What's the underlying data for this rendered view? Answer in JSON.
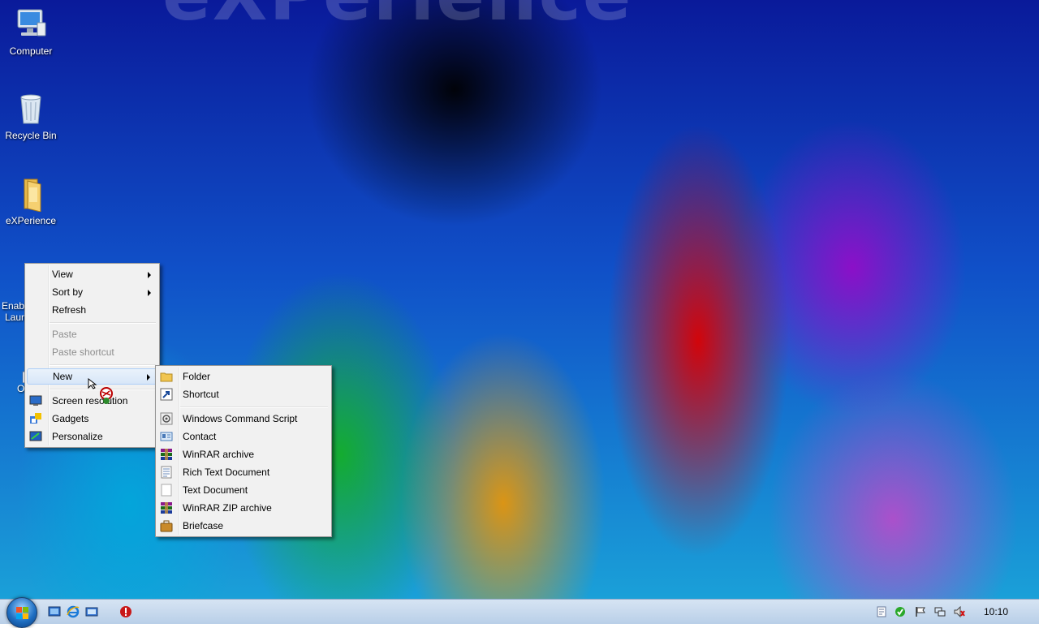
{
  "wallpaper": {
    "text": "eXPerience"
  },
  "desktop_icons": [
    {
      "label": "Computer",
      "icon": "computer-icon"
    },
    {
      "label": "Recycle Bin",
      "icon": "recycle-bin-icon"
    },
    {
      "label": "eXPerience",
      "icon": "folder-icon"
    },
    {
      "label": "Enabl",
      "label2": "Laun",
      "icon": "launcher-icon"
    },
    {
      "label": "O",
      "icon": "shortcut-app-icon"
    }
  ],
  "context_menu": {
    "items": [
      {
        "label": "View",
        "submenu": true,
        "enabled": true
      },
      {
        "label": "Sort by",
        "submenu": true,
        "enabled": true
      },
      {
        "label": "Refresh",
        "enabled": true
      },
      {
        "label": "Paste",
        "enabled": false
      },
      {
        "label": "Paste shortcut",
        "enabled": false
      },
      {
        "label": "New",
        "submenu": true,
        "enabled": true,
        "highlighted": true
      },
      {
        "label": "Screen resolution",
        "icon": "screen-resolution-icon"
      },
      {
        "label": "Gadgets",
        "icon": "gadgets-icon"
      },
      {
        "label": "Personalize",
        "icon": "personalize-icon"
      }
    ]
  },
  "new_submenu": {
    "items": [
      {
        "label": "Folder",
        "icon": "folder-icon"
      },
      {
        "label": "Shortcut",
        "icon": "shortcut-icon"
      },
      {
        "label": "Windows Command Script",
        "icon": "command-script-icon"
      },
      {
        "label": "Contact",
        "icon": "contact-icon"
      },
      {
        "label": "WinRAR archive",
        "icon": "winrar-icon"
      },
      {
        "label": "Rich Text Document",
        "icon": "rich-text-icon"
      },
      {
        "label": "Text Document",
        "icon": "text-document-icon"
      },
      {
        "label": "WinRAR ZIP archive",
        "icon": "winrar-zip-icon"
      },
      {
        "label": "Briefcase",
        "icon": "briefcase-icon"
      }
    ]
  },
  "taskbar": {
    "clock": "10:10",
    "quick_launch": [
      "show-desktop-icon",
      "internet-explorer-icon",
      "switch-windows-icon",
      "antivirus-icon"
    ],
    "tray": [
      "document-icon",
      "security-check-icon",
      "action-center-flag-icon",
      "network-icon",
      "volume-muted-icon"
    ]
  },
  "colors": {
    "menu_bg": "#f1f1f1",
    "menu_highlight": "#d8e6f8",
    "taskbar": "#c7d9ee"
  }
}
